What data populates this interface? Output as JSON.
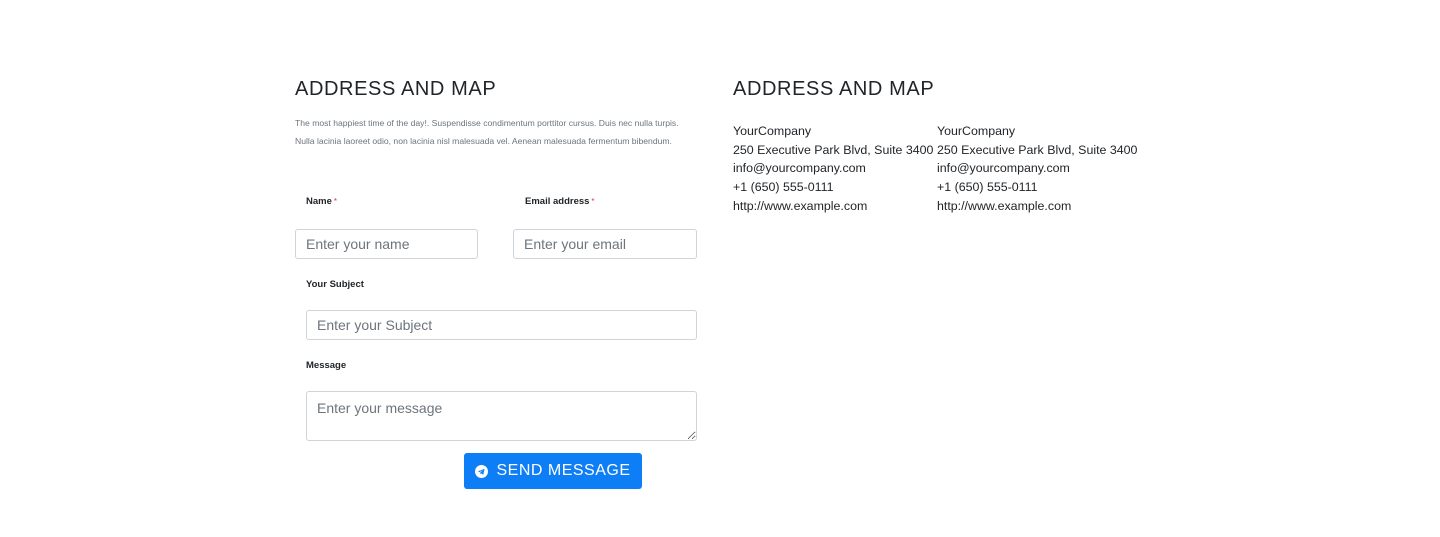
{
  "left": {
    "title": "ADDRESS AND MAP",
    "intro": "The most happiest time of the day!. Suspendisse condimentum porttitor cursus. Duis nec nulla turpis. Nulla lacinia laoreet odio, non lacinia nisl malesuada vel. Aenean malesuada fermentum bibendum.",
    "form": {
      "name_label": "Name",
      "name_placeholder": "Enter your name",
      "email_label": "Email address",
      "email_placeholder": "Enter your email",
      "required_mark": "*",
      "subject_label": "Your Subject",
      "subject_placeholder": "Enter your Subject",
      "message_label": "Message",
      "message_placeholder": "Enter your message",
      "send_label": "SEND MESSAGE",
      "send_icon": "paper-plane-icon",
      "send_color": "#0d7ef5"
    }
  },
  "right": {
    "title": "ADDRESS AND MAP",
    "addresses": [
      {
        "company": "YourCompany",
        "street": "250 Executive Park Blvd, Suite 3400",
        "email": "info@yourcompany.com",
        "phone": "+1 (650) 555-0111",
        "website": "http://www.example.com"
      },
      {
        "company": "YourCompany",
        "street": "250 Executive Park Blvd, Suite 3400",
        "email": "info@yourcompany.com",
        "phone": "+1 (650) 555-0111",
        "website": "http://www.example.com"
      }
    ]
  }
}
